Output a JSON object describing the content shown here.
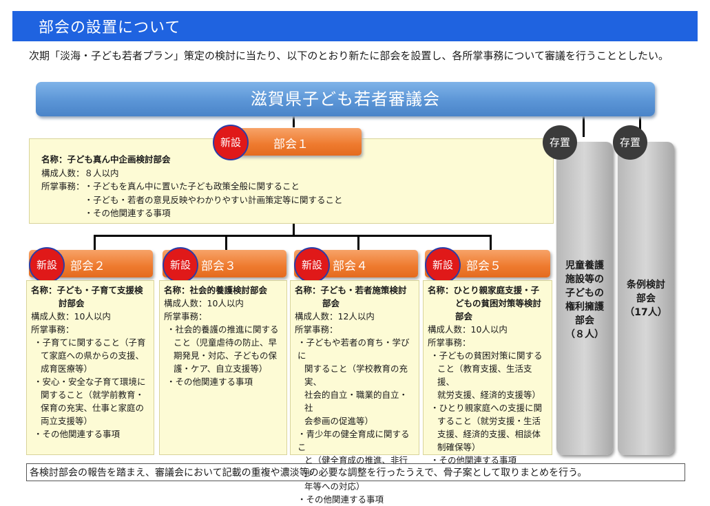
{
  "header": {
    "title": "部会の設置について"
  },
  "lead": "次期「淡海・子ども若者プラン」策定の検討に当たり、以下のとおり新たに部会を設置し、各所掌事務について審議を行うこととしたい。",
  "council": {
    "title": "滋賀県子ども若者審議会"
  },
  "badges": {
    "new": "新設",
    "existing": "存置"
  },
  "bukai1": {
    "label": "部会１",
    "name": "名称：子ども真ん中企画検討部会",
    "members": "構成人数：８人以内",
    "duties_label": "所掌事務：",
    "duties": [
      "・子どもを真ん中に置いた子ども政策全般に関すること",
      "・子ども・若者の意見反映やわかりやすい計画策定等に関すること",
      "・その他関連する事項"
    ]
  },
  "bukai2": {
    "label": "部会２",
    "name": [
      "名称：子ども・子育て支援検",
      "討部会"
    ],
    "members": "構成人数：10人以内",
    "duties_label": "所掌事務：",
    "duties": [
      "・子育てに関すること（子育",
      "て家庭への県からの支援、",
      "成育医療等）",
      "・安心・安全な子育て環境に",
      "関すること（就学前教育・",
      "保育の充実、仕事と家庭の",
      "両立支援等）",
      "・その他関連する事項"
    ]
  },
  "bukai3": {
    "label": "部会３",
    "name": [
      "名称：社会的養護検討部会"
    ],
    "members": "構成人数：10人以内",
    "duties_label": "所掌事務：",
    "duties": [
      "・社会的養護の推進に関する",
      "こと（児童虐待の防止、早",
      "期発見・対応、子どもの保",
      "護・ケア、自立支援等）",
      "・その他関連する事項"
    ]
  },
  "bukai4": {
    "label": "部会４",
    "name": [
      "名称：子ども・若者施策検討",
      "部会"
    ],
    "members": "構成人数：12人以内",
    "duties_label": "所掌事務：",
    "duties": [
      "・子どもや若者の育ち・学びに",
      "関すること（学校教育の充実、",
      "社会的自立・職業的自立・社",
      "会参画の促進等）",
      "・青少年の健全育成に関するこ",
      "と（健全育成の推進、非行少",
      "年等への対応）",
      "・その他関連する事項"
    ]
  },
  "bukai5": {
    "label": "部会５",
    "name": [
      "名称：ひとり親家庭支援・子",
      "どもの貧困対策等検討",
      "部会"
    ],
    "members": "構成人数：10人以内",
    "duties_label": "所掌事務：",
    "duties": [
      "・子どもの貧困対策に関する",
      "こと（教育支援、生活支援、",
      "就労支援、経済的支援等）",
      "・ひとり親家庭への支援に関",
      "すること（就労支援・生活",
      "支援、経済的支援、相談体",
      "制確保等）",
      "・その他関連する事項"
    ]
  },
  "existing1": {
    "lines": [
      "児童養護",
      "施設等の",
      "子どもの",
      "権利擁護",
      "部会",
      "（８人）"
    ]
  },
  "existing2": {
    "lines": [
      "条例検討",
      "部会",
      "（17人）"
    ]
  },
  "footer": "各検討部会の報告を踏まえ、審議会において記載の重複や濃淡等の必要な調整を行ったうえで、骨子案として取りまとめを行う。",
  "colors": {
    "header": "#1f63e0",
    "council": "#5b95d6",
    "orange": "#ee7a2e",
    "new_badge": "#e01919",
    "existing_badge": "#3b3b3b",
    "note_bg": "#fdfbd5"
  }
}
